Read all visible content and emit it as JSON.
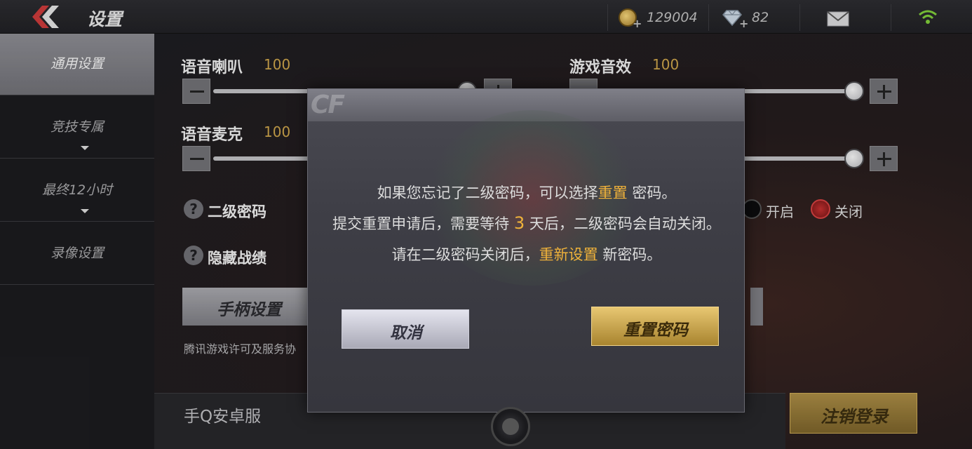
{
  "header": {
    "title": "设置",
    "gold_amount": "129004",
    "diamond_amount": "82",
    "plus_sign": "+"
  },
  "sidebar": {
    "items": [
      {
        "label": "通用设置",
        "active": true
      },
      {
        "label": "竞技专属",
        "active": false
      },
      {
        "label": "最终12小时",
        "active": false
      },
      {
        "label": "录像设置",
        "active": false
      }
    ]
  },
  "sliders": {
    "voice_speaker": {
      "label": "语音喇叭",
      "value": "100"
    },
    "game_sound": {
      "label": "游戏音效",
      "value": "100"
    },
    "voice_mic": {
      "label": "语音麦克",
      "value": "100"
    }
  },
  "options": {
    "secondary_password": {
      "label": "二级密码",
      "on_label": "开启",
      "off_label": "关闭",
      "selected": "off"
    },
    "hide_record": {
      "label": "隐藏战绩"
    }
  },
  "buttons": {
    "gamepad_settings": "手柄设置",
    "logout": "注销登录"
  },
  "license_link": "腾讯游戏许可及服务协",
  "server_label": "手Q安卓服",
  "dialog": {
    "line1_before": "如果您忘记了二级密码，可以选择",
    "line1_highlight": "重置",
    "line1_after": " 密码。",
    "line2_before": "提交重置申请后，需要等待 ",
    "line2_number": "3",
    "line2_after": " 天后，二级密码会自动关闭。",
    "line3_before": "请在二级密码关闭后，",
    "line3_highlight": "重新设置",
    "line3_after": " 新密码。",
    "cancel_label": "取消",
    "reset_label": "重置密码"
  },
  "colors": {
    "highlight": "#f0b23a",
    "gold_button": "#c9a24a",
    "radio_checked": "#c23030"
  },
  "icons": [
    "back-chevron-icon",
    "gold-coin-icon",
    "diamond-icon",
    "mail-icon",
    "wifi-icon",
    "help-icon"
  ]
}
